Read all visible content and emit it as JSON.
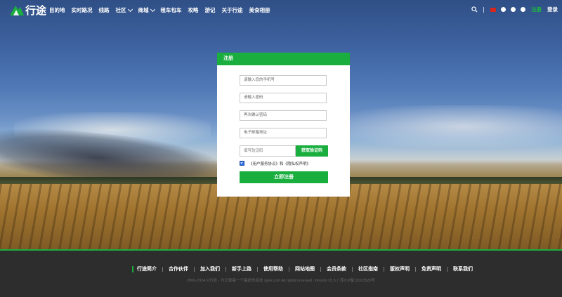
{
  "brand": {
    "logo_text": "行途"
  },
  "nav": {
    "items": [
      {
        "label": "目的地",
        "has_dropdown": false
      },
      {
        "label": "实时路况",
        "has_dropdown": false
      },
      {
        "label": "线路",
        "has_dropdown": false
      },
      {
        "label": "社区",
        "has_dropdown": true
      },
      {
        "label": "商城",
        "has_dropdown": true
      },
      {
        "label": "租车包车",
        "has_dropdown": false
      },
      {
        "label": "攻略",
        "has_dropdown": false
      },
      {
        "label": "游记",
        "has_dropdown": false
      },
      {
        "label": "关于行途",
        "has_dropdown": false
      },
      {
        "label": "美食相册",
        "has_dropdown": false
      }
    ]
  },
  "top_right": {
    "icons": [
      "search-icon",
      "china-flag-icon",
      "qq-icon",
      "wechat-icon",
      "weibo-icon"
    ],
    "register_label": "注册",
    "login_label": "登录"
  },
  "register_card": {
    "title": "注册",
    "phone_placeholder": "请输入您的手机号",
    "password_placeholder": "请输入密码",
    "confirm_placeholder": "再次确认密码",
    "email_placeholder": "电子邮箱地址",
    "code_placeholder": "填写验证码",
    "get_code_label": "获取验证码",
    "agreement_text": "《用户服务协议》和《隐私权声明》",
    "agreement_checked": true,
    "submit_label": "立即注册"
  },
  "footer": {
    "links": [
      "行途简介",
      "合作伙伴",
      "加入我们",
      "新手上路",
      "使用帮助",
      "网站地图",
      "会员条款",
      "社区指南",
      "版权声明",
      "免责声明",
      "联系我们"
    ],
    "copyright": "2006-2024 ©行途 - 为记录每一个路途的足迹 xjyer.com All rights reserved. Version v5.5.7 苏ICP备12003526号"
  },
  "colors": {
    "accent": "#1aae3f",
    "footer_bg": "#2d2d2d"
  }
}
